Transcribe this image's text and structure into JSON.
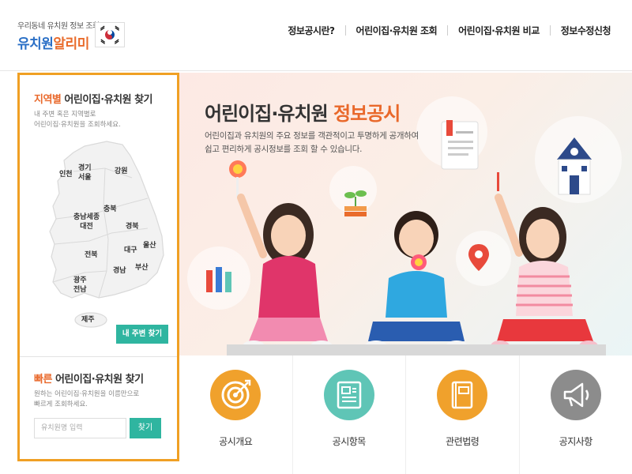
{
  "header": {
    "logo_sub": "우리동네 유치원 정보 조회",
    "logo_main_blue": "유치원",
    "logo_main_orange": "알리미",
    "nav": [
      "정보공시란?",
      "어린이집·유치원 조회",
      "어린이집·유치원 비교",
      "정보수정신청"
    ]
  },
  "left_panel": {
    "region_title_accent": "지역별",
    "region_title_rest": " 어린이집·유치원 찾기",
    "region_desc": "내 주변 혹은 지역별로\n어린이집·유치원을 조회하세요.",
    "regions": [
      "인천",
      "경기\n서울",
      "강원",
      "충북",
      "충남세종\n대전",
      "경북",
      "대구",
      "울산",
      "전북",
      "경남",
      "부산",
      "광주\n전남",
      "제주"
    ],
    "near_button": "내 주변 찾기",
    "fast_title_accent": "빠른",
    "fast_title_rest": " 어린이집·유치원 찾기",
    "fast_desc": "원하는 어린이집·유치원을 이름만으로\n빠르게 조회하세요.",
    "search_placeholder": "유치원명 입력",
    "search_button": "찾기"
  },
  "hero": {
    "title_main": "어린이집·유치원 ",
    "title_accent": "정보공시",
    "desc": "어린이집과 유치원의 주요 정보를 객관적이고 투명하게 공개하여\n쉽고 편리하게 공시정보를 조회 할 수 있습니다."
  },
  "cards": [
    {
      "label": "공시개요",
      "color": "#f0a12c",
      "icon": "target-icon"
    },
    {
      "label": "공시항목",
      "color": "#5fc5b6",
      "icon": "document-icon"
    },
    {
      "label": "관련법령",
      "color": "#f0a12c",
      "icon": "book-icon"
    },
    {
      "label": "공지사항",
      "color": "#8c8c8c",
      "icon": "megaphone-icon"
    }
  ],
  "colors": {
    "accent_orange": "#e9682a",
    "panel_border": "#f0a024",
    "teal_button": "#2fb5a0",
    "logo_blue": "#2a6fc6"
  }
}
